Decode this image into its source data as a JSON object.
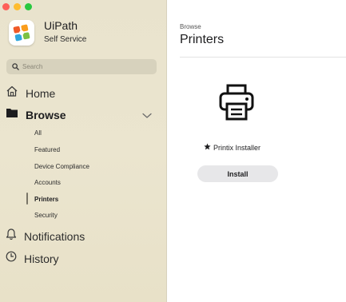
{
  "window": {
    "controls": [
      "close",
      "minimize",
      "maximize"
    ]
  },
  "app": {
    "title": "UiPath",
    "subtitle": "Self Service",
    "icon": "uipath-logo-icon"
  },
  "search": {
    "placeholder": "Search",
    "value": ""
  },
  "nav": {
    "home": {
      "label": "Home",
      "icon": "home-icon"
    },
    "browse": {
      "label": "Browse",
      "icon": "folder-icon",
      "expanded": true
    },
    "notifications": {
      "label": "Notifications",
      "icon": "bell-icon"
    },
    "history": {
      "label": "History",
      "icon": "clock-icon"
    }
  },
  "browse_items": [
    {
      "label": "All"
    },
    {
      "label": "Featured"
    },
    {
      "label": "Device Compliance"
    },
    {
      "label": "Accounts"
    },
    {
      "label": "Printers",
      "selected": true
    },
    {
      "label": "Security"
    }
  ],
  "main": {
    "breadcrumb": "Browse",
    "title": "Printers",
    "items": [
      {
        "name": "Printix Installer",
        "icon": "printer-icon",
        "featured_icon": "star-icon",
        "button_label": "Install"
      }
    ]
  },
  "colors": {
    "sidebar_bg": "#ebe5cf",
    "close": "#fe5f57",
    "minimize": "#febc2e",
    "maximize": "#28c840",
    "button_bg": "#e7e7e9"
  }
}
